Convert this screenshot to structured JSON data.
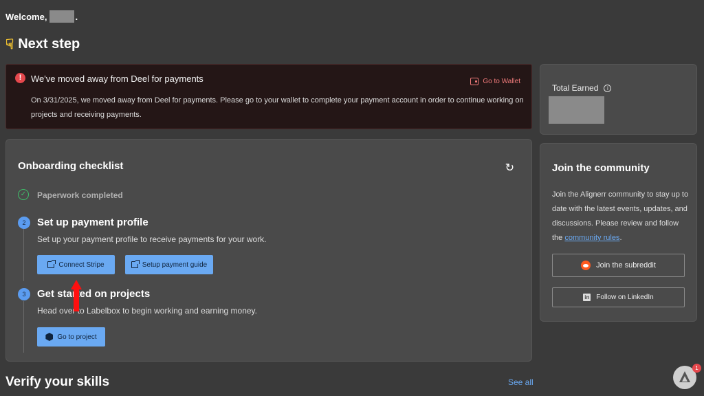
{
  "header": {
    "welcome": "Welcome,",
    "dot": ".",
    "next_step": "Next step"
  },
  "alert": {
    "title": "We've moved away from Deel for payments",
    "body": "On 3/31/2025, we moved away from Deel for payments. Please go to your wallet to complete your payment account in order to continue working on projects and receiving payments.",
    "action": "Go to Wallet",
    "accent_color": "#e5484d"
  },
  "checklist": {
    "title": "Onboarding checklist",
    "steps": [
      {
        "label": "Paperwork completed",
        "completed": true
      },
      {
        "number": "2",
        "title": "Set up payment profile",
        "description": "Set up your payment profile to receive payments for your work.",
        "buttons": [
          "Connect Stripe",
          "Setup payment guide"
        ]
      },
      {
        "number": "3",
        "title": "Get started on projects",
        "description": "Head over to Labelbox to begin working and earning money.",
        "buttons": [
          "Go to project"
        ]
      }
    ]
  },
  "earned": {
    "label": "Total Earned"
  },
  "community": {
    "title": "Join the community",
    "description": "Join the Alignerr community to stay up to date with the latest events, updates, and discussions. Please review and follow the",
    "link": "community rules",
    "link_suffix": ".",
    "subreddit_button": "Join the subreddit",
    "linkedin_button": "Follow on LinkedIn"
  },
  "skills": {
    "title": "Verify your skills",
    "see_all": "See all"
  },
  "fab": {
    "badge": "1"
  }
}
